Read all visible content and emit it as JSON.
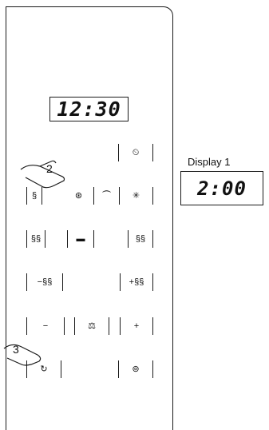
{
  "main_display": {
    "value": "12:30"
  },
  "side_display": {
    "label": "Display 1",
    "value": "2:00"
  },
  "callouts": [
    "2",
    "3"
  ],
  "keys": {
    "clock": "⏲",
    "grill_low": "§",
    "combi": "⊛",
    "steam": "⏜",
    "defrost": "✳",
    "grill_med": "§§",
    "top_heat": "▬",
    "top_bottom": "§§",
    "minus_grill": "−§§",
    "plus_grill": "+§§",
    "minus": "−",
    "weight": "⚖",
    "plus": "+",
    "power": "↻",
    "stop": "⊚"
  }
}
